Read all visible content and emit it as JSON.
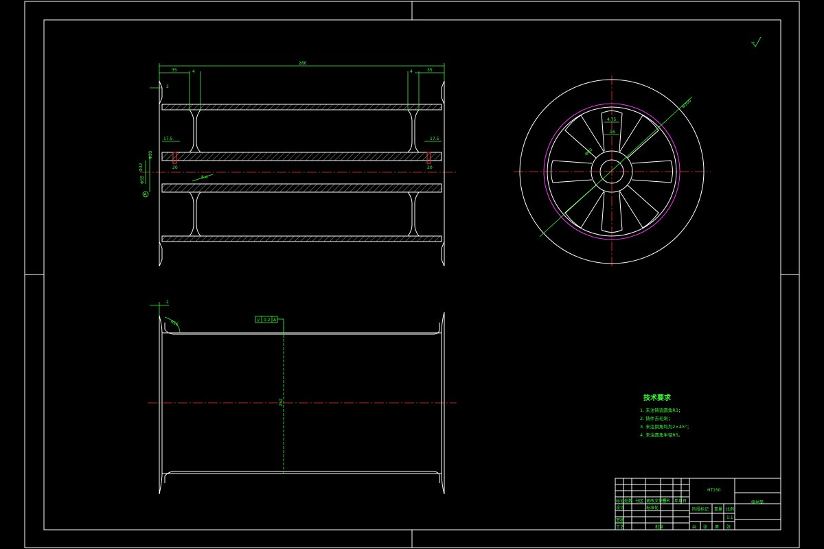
{
  "drawing": {
    "type": "engineering-drawing",
    "background": "#000000",
    "colors": {
      "outline": "#ffffff",
      "dimension": "#33ff33",
      "centerline": "#ff3333",
      "pitch_circle": "#ff33ff"
    }
  },
  "front_view": {
    "dim_overall": "280",
    "dim_left_flange": "35",
    "dim_right_flange": "35",
    "dim_left_web": "4",
    "dim_right_web": "4",
    "dim_flange_lip": "2",
    "dim_left_bore": "17.5",
    "dim_right_bore": "17.5",
    "dim_left_groove": "20",
    "dim_right_groove": "20",
    "dim_shaft": "8.4",
    "dim_bore_dia": "Φ33",
    "dim_hub_dia": "Φ32",
    "dim_hub_outer": "Φ55",
    "datum": "A"
  },
  "side_view": {
    "dim_outer": "Φ300",
    "dim_inner": "Φ80",
    "dim_spoke_width": "4.75",
    "dim_spoke_depth": "16"
  },
  "bottom_view": {
    "dim_flange": "2",
    "dim_radius": "R16",
    "dim_length": "252",
    "tolerance_frame": [
      "//",
      "0.2",
      "A"
    ]
  },
  "roughness_symbol": "✓",
  "tech_requirements": {
    "title": "技术要求",
    "items": [
      "1. 未注铸造圆角R3；",
      "2. 铸件去毛刺；",
      "3. 未注倒角均为2×45°；",
      "4. 未注圆角半径R5。"
    ]
  },
  "title_block": {
    "material": "HT150",
    "part_name": "绕丝筒",
    "labels": {
      "mark": "标记",
      "count": "处数",
      "zone": "分区",
      "change_doc": "更改文件号",
      "signature": "签名",
      "date": "年月日",
      "design": "设计",
      "standardize": "标准化",
      "stage_mark": "阶段标记",
      "weight": "重量",
      "scale": "比例",
      "review": "审核",
      "process": "工艺",
      "approve": "批准",
      "sheet_total": "共",
      "sheet": "张",
      "sheet_no": "第",
      "scale_value": "1:1"
    }
  }
}
